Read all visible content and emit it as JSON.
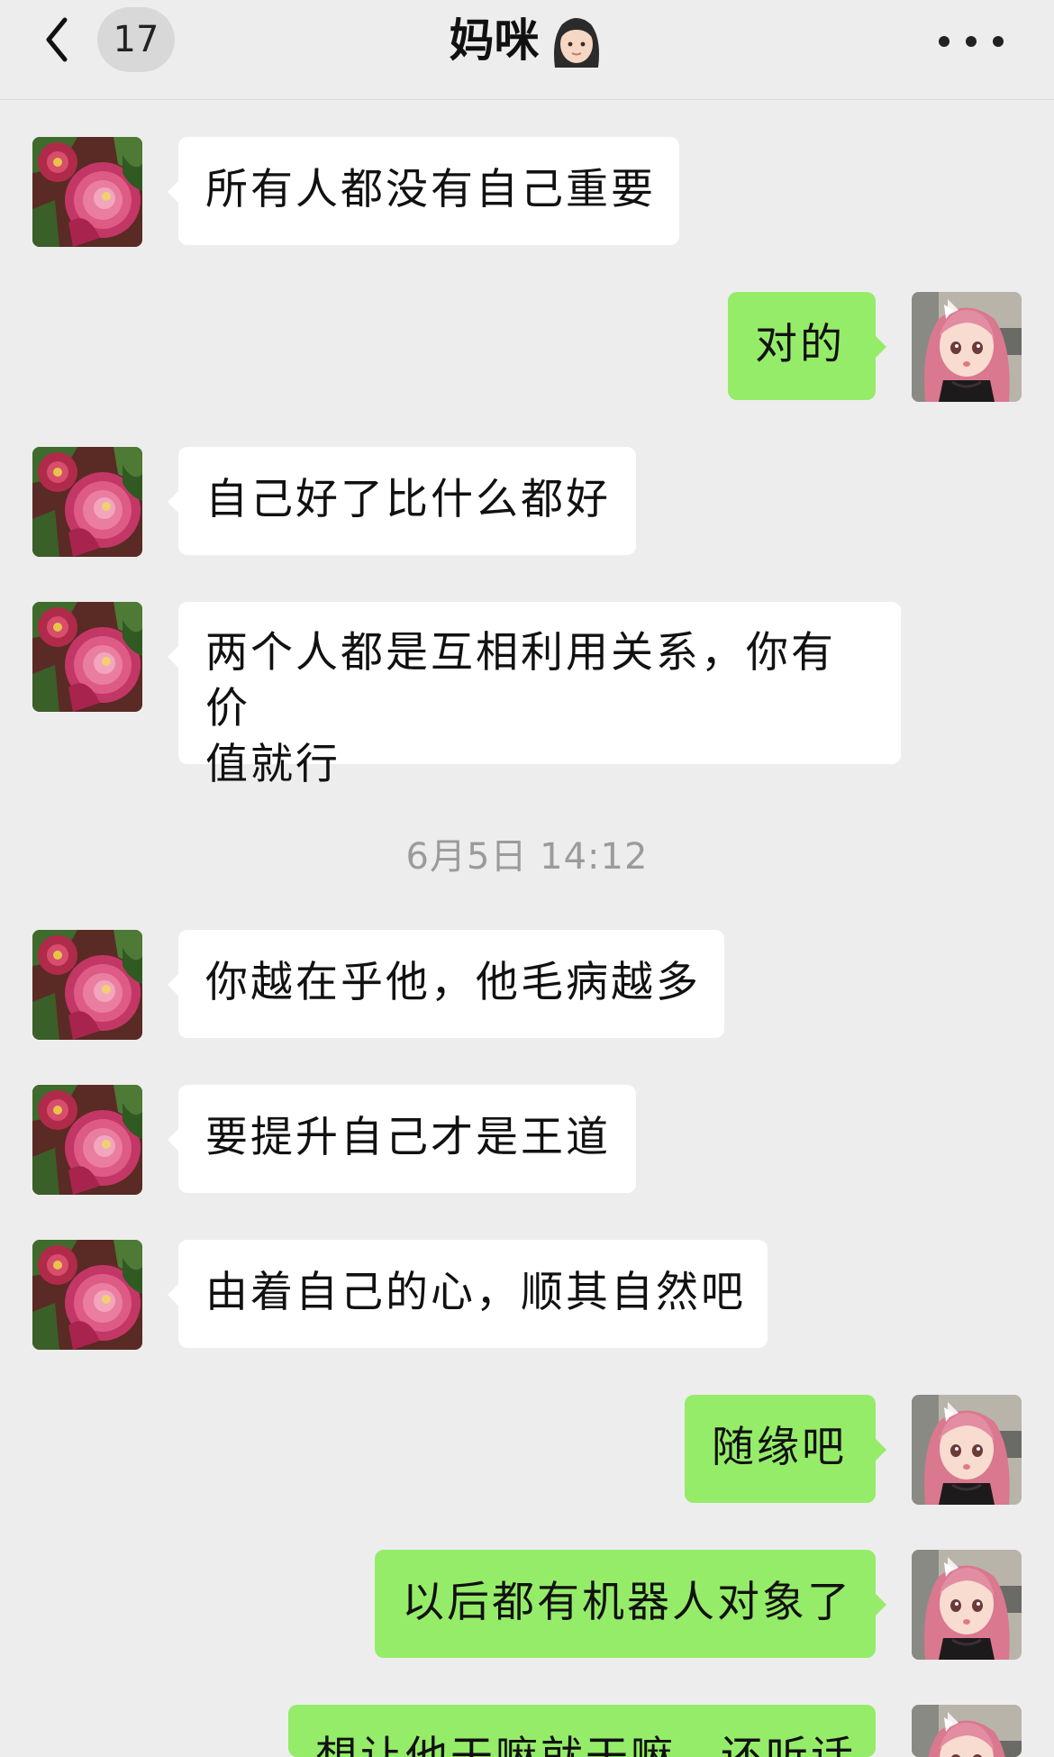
{
  "header": {
    "unread_count": "17",
    "title": "妈咪"
  },
  "timestamp": "6月5日 14:12",
  "messages": [
    {
      "text": "所有人都没有自己重要"
    },
    {
      "text": "对的"
    },
    {
      "text": "自己好了比什么都好"
    },
    {
      "line1": "两个人都是互相利用关系，你有价",
      "line2": "值就行"
    },
    {
      "text": "你越在乎他，他毛病越多"
    },
    {
      "text": "要提升自己才是王道"
    },
    {
      "text": "由着自己的心，顺其自然吧"
    },
    {
      "text": "随缘吧"
    },
    {
      "text": "以后都有机器人对象了"
    },
    {
      "text": "想让他干嘛就干嘛，还听话"
    }
  ],
  "colors": {
    "background": "#ededed",
    "incoming_bubble": "#ffffff",
    "outgoing_bubble": "#95ec69",
    "timestamp_text": "#9b9b9b"
  },
  "icons": {
    "back": "chevron-left-icon",
    "more": "more-horizontal-icon",
    "title_emoji": "woman-face-emoji-icon",
    "contact_avatar": "peony-flower-avatar",
    "my_avatar": "pink-hair-girl-avatar"
  }
}
